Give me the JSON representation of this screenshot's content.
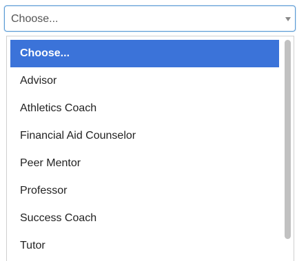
{
  "select": {
    "value": "Choose...",
    "caret_icon": "caret-down-icon"
  },
  "dropdown": {
    "selected_index": 0,
    "selected_color": "#3b73d9",
    "options": [
      "Choose...",
      "Advisor",
      "Athletics Coach",
      "Financial Aid Counselor",
      "Peer Mentor",
      "Professor",
      "Success Coach",
      "Tutor"
    ]
  }
}
